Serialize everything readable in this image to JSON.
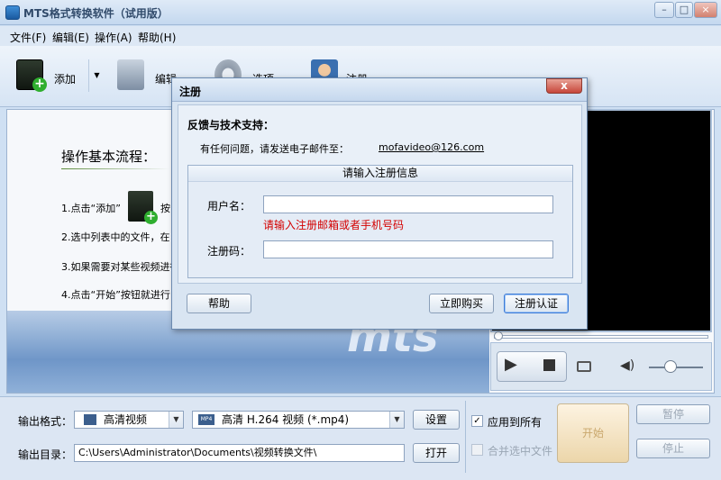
{
  "window": {
    "title": "MTS格式转换软件（试用版）",
    "minimize": "–",
    "maximize": "□",
    "close": "×"
  },
  "menu": [
    "文件(F)",
    "编辑(E)",
    "操作(A)",
    "帮助(H)"
  ],
  "toolbar": {
    "add": "添加",
    "edit": "编辑",
    "options": "选项",
    "register": "注册"
  },
  "steps": {
    "heading": "操作基本流程：",
    "s1": "1.点击“添加”",
    "s1b": "按",
    "s2": "2.选中列表中的文件，在",
    "s3": "3.如果需要对某些视频进行",
    "s4": "4.点击“开始”按钮就进行"
  },
  "banner": {
    "text": "mts"
  },
  "bottom": {
    "format_label": "输出格式：",
    "format_category": "高清视频",
    "format_value": "高清 H.264 视频 (*.mp4)",
    "settings_button": "设置",
    "dir_label": "输出目录：",
    "dir_value": "C:\\Users\\Administrator\\Documents\\视频转换文件\\",
    "open_button": "打开",
    "apply_all": "应用到所有",
    "merge_selected": "合并选中文件",
    "start": "开始",
    "pause": "暂停",
    "stop": "停止"
  },
  "dialog": {
    "title": "注册",
    "close": "x",
    "support_heading": "反馈与技术支持：",
    "support_text": "有任何问题，请发送电子邮件至：",
    "email": "mofavideo@126.com",
    "group_title": "请输入注册信息",
    "username_label": "用户名：",
    "username_hint": "请输入注册邮箱或者手机号码",
    "code_label": "注册码：",
    "help_button": "帮助",
    "buy_button": "立即购买",
    "verify_button": "注册认证"
  },
  "colors": {
    "hint_red": "#d40000",
    "title_text": "#304a6a"
  }
}
